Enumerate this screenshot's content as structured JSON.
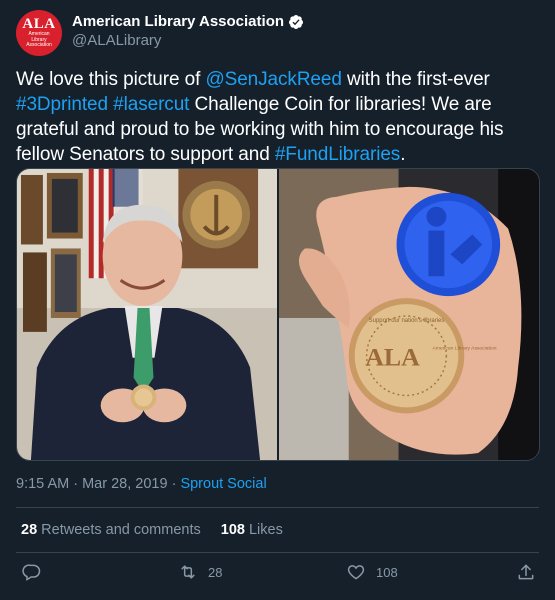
{
  "account": {
    "display_name": "American Library Association",
    "handle": "@ALALibrary",
    "avatar_big": "ALA",
    "avatar_lines": [
      "American",
      "Library",
      "Association"
    ]
  },
  "tweet": {
    "parts": [
      {
        "text": "We love this picture of ",
        "link": false
      },
      {
        "text": "@SenJackReed",
        "link": true
      },
      {
        "text": " with the first-ever ",
        "link": false
      },
      {
        "text": "#3Dprinted",
        "link": true
      },
      {
        "text": " ",
        "link": false
      },
      {
        "text": "#lasercut",
        "link": true
      },
      {
        "text": " Challenge Coin for libraries! We are grateful and proud to be working with him to encourage his fellow Senators to support and ",
        "link": false
      },
      {
        "text": "#FundLibraries",
        "link": true
      },
      {
        "text": ".",
        "link": false
      }
    ]
  },
  "coin": {
    "front_text": "ALA",
    "front_small": "American Library Association",
    "ring_text": "Support our nation's libraries"
  },
  "meta": {
    "time": "9:15 AM",
    "sep": " · ",
    "date": "Mar 28, 2019",
    "source": "Sprout Social"
  },
  "stats": {
    "retweets_count": "28",
    "retweets_label": "Retweets and comments",
    "likes_count": "108",
    "likes_label": "Likes"
  },
  "actions": {
    "retweet_count": "28",
    "like_count": "108"
  },
  "colors": {
    "background": "#15202b",
    "accent": "#1da1f2",
    "muted": "#8899a6",
    "divider": "#38444d",
    "ala_red": "#d8212c"
  }
}
